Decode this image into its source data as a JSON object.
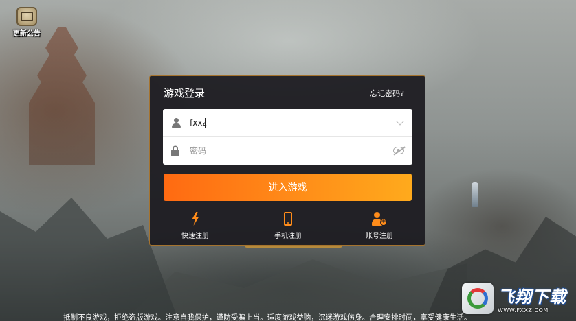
{
  "notice": {
    "label": "更新公告"
  },
  "login": {
    "title": "游戏登录",
    "forgot_label": "忘记密码?",
    "account_value": "fxxz",
    "password_placeholder": "密码",
    "enter_label": "进入游戏"
  },
  "quick_actions": [
    {
      "label": "快速注册",
      "icon": "lightning-icon"
    },
    {
      "label": "手机注册",
      "icon": "phone-icon"
    },
    {
      "label": "账号注册",
      "icon": "add-account-icon"
    }
  ],
  "footer": {
    "text": "抵制不良游戏，拒绝盗版游戏。注意自我保护，谨防受骗上当。适度游戏益脑，沉迷游戏伤身。合理安排时间，享受健康生活。"
  },
  "watermark": {
    "name": "飞翔下载",
    "url": "WWW.FXXZ.COM"
  },
  "colors": {
    "accent": "#ff8c1a",
    "panel_border": "#a5732e",
    "button_start": "#ff6a12",
    "button_end": "#ffaa1c"
  }
}
